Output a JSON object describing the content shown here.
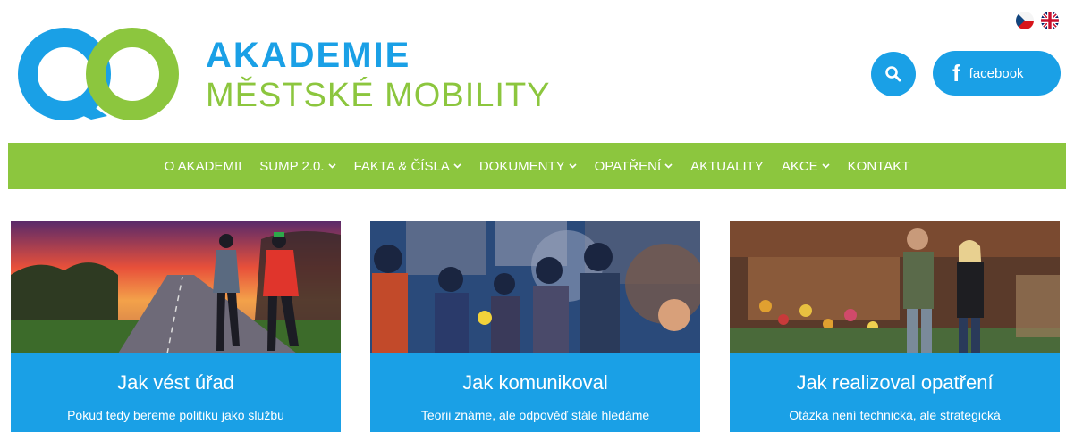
{
  "header": {
    "brand_line1": "AKADEMIE",
    "brand_line2": "MĚSTSKÉ MOBILITY",
    "facebook_label": "facebook",
    "search_icon": "search-icon",
    "facebook_icon": "facebook-icon",
    "languages": [
      "cz-flag-icon",
      "uk-flag-icon"
    ]
  },
  "nav": {
    "items": [
      {
        "label": "O AKADEMII",
        "dropdown": false
      },
      {
        "label": "SUMP 2.0.",
        "dropdown": true
      },
      {
        "label": "FAKTA & ČÍSLA",
        "dropdown": true
      },
      {
        "label": "DOKUMENTY",
        "dropdown": true
      },
      {
        "label": "OPATŘENÍ",
        "dropdown": true
      },
      {
        "label": "AKTUALITY",
        "dropdown": false
      },
      {
        "label": "AKCE",
        "dropdown": true
      },
      {
        "label": "KONTAKT",
        "dropdown": false
      }
    ]
  },
  "cards": [
    {
      "title": "Jak vést úřad",
      "subtitle": "Pokud tedy bereme politiku jako službu"
    },
    {
      "title": "Jak komunikoval",
      "subtitle": "Teorii známe, ale odpověď stále hledáme"
    },
    {
      "title": "Jak realizoval opatření",
      "subtitle": "Otázka není technická, ale strategická"
    }
  ],
  "colors": {
    "brand_blue": "#1aa0e6",
    "brand_green": "#8cc63e",
    "white": "#ffffff"
  }
}
